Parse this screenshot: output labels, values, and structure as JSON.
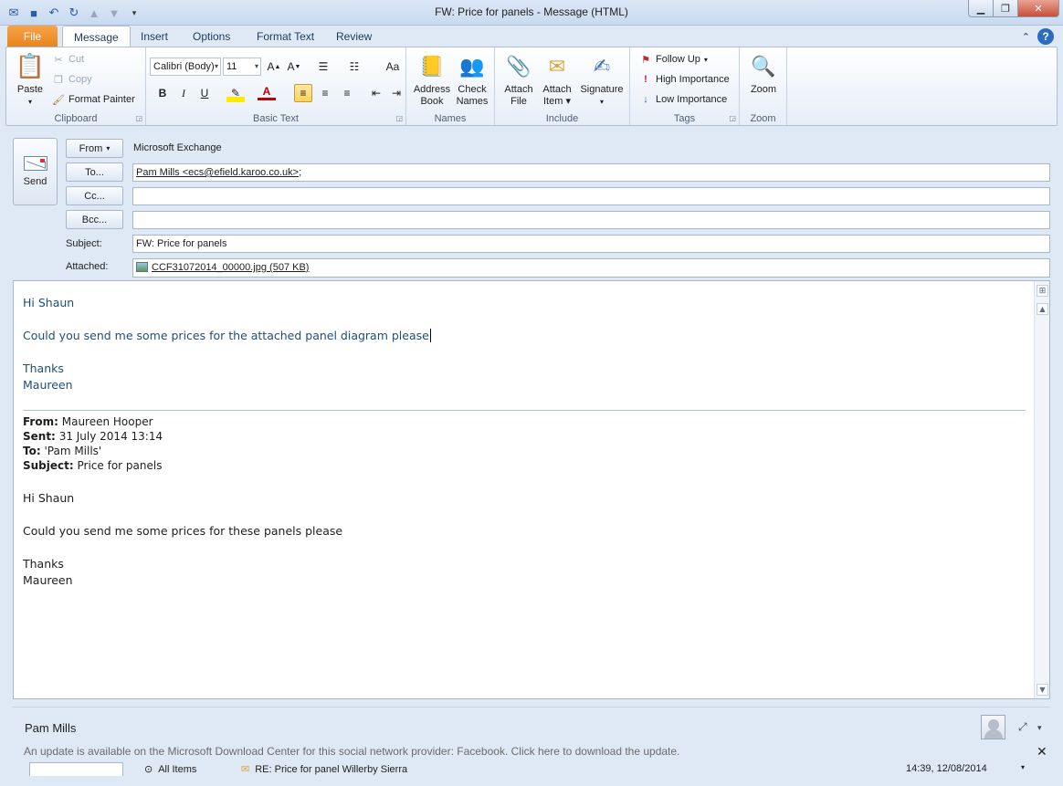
{
  "window": {
    "title": "FW: Price for panels  -  Message (HTML)"
  },
  "tabs": [
    "File",
    "Message",
    "Insert",
    "Options",
    "Format Text",
    "Review"
  ],
  "ribbon": {
    "clipboard": {
      "label": "Clipboard",
      "paste": "Paste",
      "cut": "Cut",
      "copy": "Copy",
      "format_painter": "Format Painter"
    },
    "basic_text": {
      "label": "Basic Text",
      "font": "Calibri (Body)",
      "size": "11"
    },
    "names": {
      "label": "Names",
      "address_book_1": "Address",
      "address_book_2": "Book",
      "check_names_1": "Check",
      "check_names_2": "Names"
    },
    "include": {
      "label": "Include",
      "attach_file_1": "Attach",
      "attach_file_2": "File",
      "attach_item_1": "Attach",
      "attach_item_2": "Item",
      "signature": "Signature"
    },
    "tags": {
      "label": "Tags",
      "follow_up": "Follow Up",
      "high_importance": "High Importance",
      "low_importance": "Low Importance"
    },
    "zoom": {
      "label": "Zoom",
      "zoom": "Zoom"
    }
  },
  "header": {
    "send": "Send",
    "from_btn": "From",
    "from_value": "Microsoft Exchange",
    "to_btn": "To...",
    "to_value": "Pam Mills <ecs@efield.karoo.co.uk>",
    "to_suffix": ";",
    "cc_btn": "Cc...",
    "bcc_btn": "Bcc...",
    "subject_label": "Subject:",
    "subject_value": "FW: Price for panels",
    "attached_label": "Attached:",
    "attachment": "CCF31072014_00000.jpg (507 KB)"
  },
  "body": {
    "greeting": "Hi Shaun",
    "line1": "Could you send me some prices for the attached panel diagram please",
    "thanks": "Thanks",
    "sign": "Maureen",
    "fwd_from_label": "From:",
    "fwd_from": "Maureen Hooper",
    "fwd_sent_label": "Sent:",
    "fwd_sent": "31 July 2014 13:14",
    "fwd_to_label": "To:",
    "fwd_to": "'Pam Mills'",
    "fwd_subject_label": "Subject:",
    "fwd_subject": "Price for panels",
    "fwd_greeting": "Hi Shaun",
    "fwd_line1": "Could you send me some prices for these panels please",
    "fwd_thanks": "Thanks",
    "fwd_sign": "Maureen"
  },
  "people_pane": {
    "name": "Pam Mills",
    "update_msg": "An update is available on the Microsoft Download Center for this social network provider: Facebook. Click here to download the update.",
    "all_items": "All Items",
    "activity_subject": "RE: Price for panel Willerby Sierra",
    "activity_time": "14:39, 12/08/2014"
  }
}
